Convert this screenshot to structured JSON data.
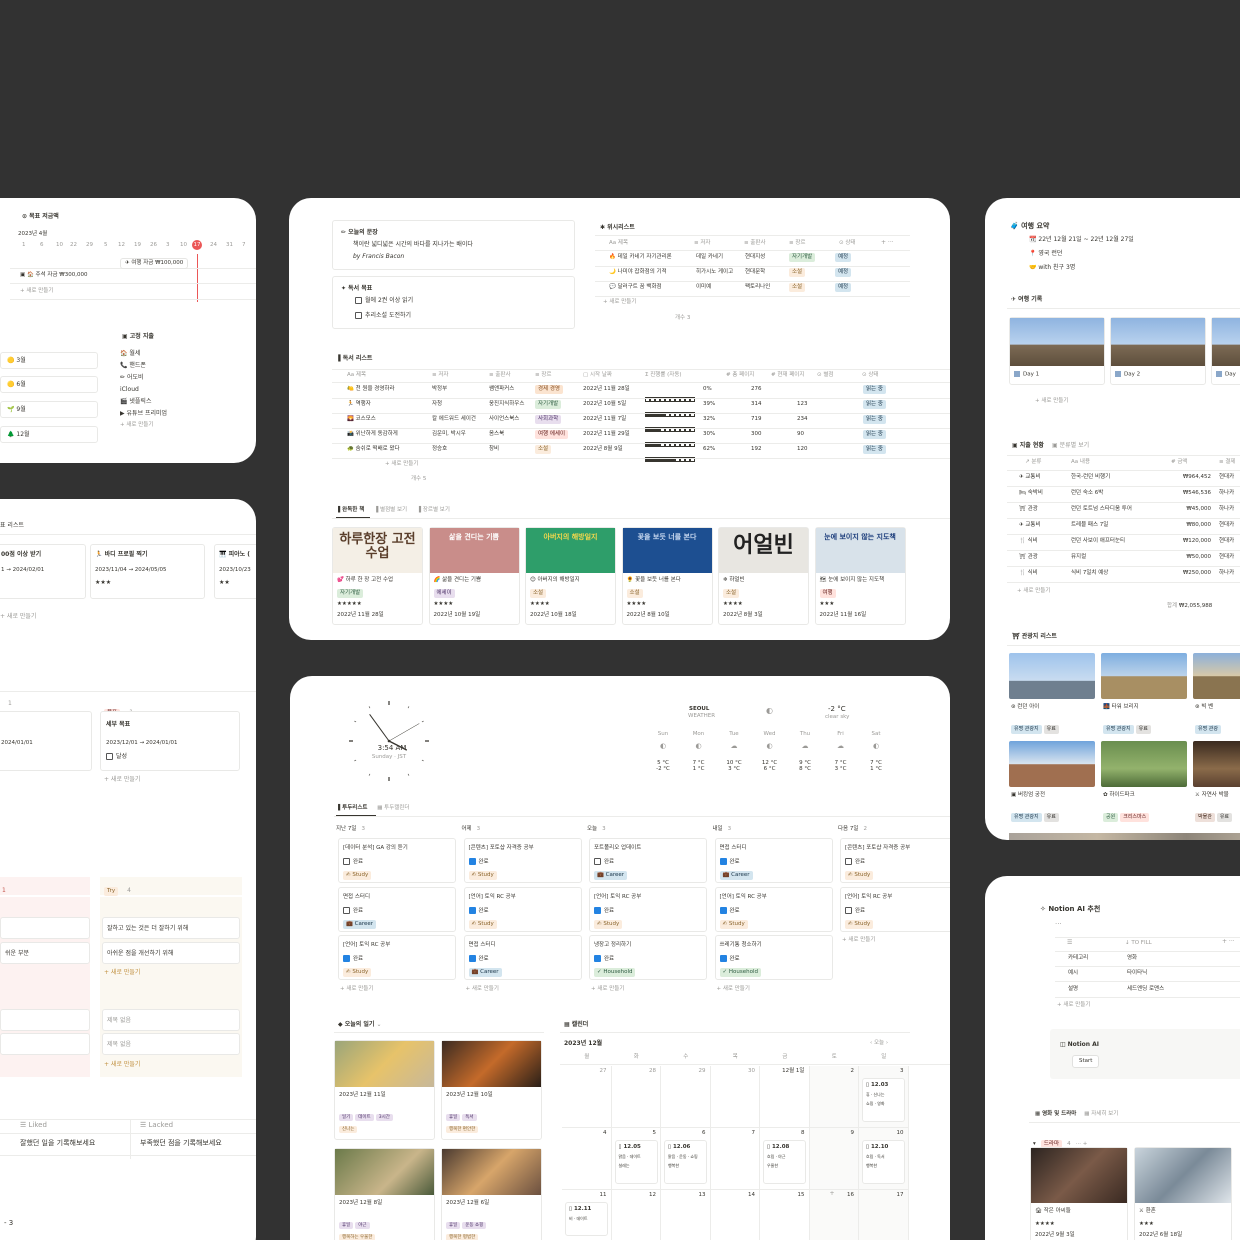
{
  "colors": {
    "bg": "#323232",
    "accent_red": "#eb5757",
    "blue": "#2383e2"
  },
  "saving": {
    "title": "목표 저금액",
    "month": "2023년 4월",
    "days": [
      "1",
      "6",
      "10",
      "22",
      "29",
      "5",
      "12",
      "19",
      "26",
      "3",
      "10",
      "17",
      "24",
      "31",
      "7"
    ],
    "today": "17",
    "bar1": "주석 자금  ₩300,000",
    "bar2": "여행 자금  ₩100,000",
    "add": "+ 새로 만들기"
  },
  "fixed": {
    "title": "고정 지출",
    "items": [
      "월세",
      "핸드폰",
      "어도비",
      "iCloud",
      "넷플릭스",
      "유튜브 프리미엄"
    ],
    "add": "+ 새로 만들기"
  },
  "months": [
    "3월",
    "6월",
    "9월",
    "12월"
  ],
  "goals": {
    "title": "표 리스트",
    "c1_title": "00점 이상 받기",
    "c1_date": "1 → 2024/02/01",
    "c2_title": "바디 프로필 찍기",
    "c2_date": "2023/11/04 → 2024/05/05",
    "c2_stars": "★★★",
    "c3_title": "피아노 (",
    "c3_date": "2023/10/23",
    "c3_stars": "★★",
    "add": "+ 새로 만들기"
  },
  "board": {
    "h1": "1",
    "h2_tag": "목표",
    "h2_count": "1",
    "c1_date": "2024/01/01",
    "c2_title": "세부 목표",
    "c2_date": "2023/12/01 → 2024/01/01",
    "c2_check": "달성",
    "add": "+ 새로 만들기"
  },
  "retro": {
    "try_tag": "Try",
    "try_count": "4",
    "left_tag": "",
    "row1": "잘하고 있는 것은 더 잘하기 위해",
    "row2_left": "쉬운 부분",
    "row2": "아쉬운 점을 개선하기 위해",
    "add": "+ 새로 만들기",
    "e1": "제목 없음",
    "e2": "제목 없음",
    "add2": "+ 새로 만들기"
  },
  "liked": {
    "h1": "Liked",
    "h2": "Lacked",
    "r1": "잘했던 일을 기록해보세요",
    "r2": "부족했던 점을 기록해보세요",
    "count": "3"
  },
  "quote": {
    "label": "오늘의 문장",
    "text": "책이란 넓디넓은 시간의 바다를 지나가는 배이다",
    "author": "by Francis Bacon"
  },
  "reading_goal": {
    "label": "독서 목표",
    "g1": "월에 2권 이상 읽기",
    "g2": "추리소설 도전하기"
  },
  "wish": {
    "title": "위시리스트",
    "cols": [
      "Aa 제목",
      "저자",
      "출판사",
      "장르",
      "상태"
    ],
    "rows": [
      [
        "데일 카네기 자기관리론",
        "데일 카네기",
        "현대지성",
        "자기개발",
        "예정"
      ],
      [
        "나미야 잡화점의 기적",
        "히가시노 게이고",
        "현대문학",
        "소설",
        "예정"
      ],
      [
        "달러구트 꿈 백화점",
        "이미예",
        "팩토리나인",
        "소설",
        "예정"
      ]
    ],
    "add": "+ 새로 만들기",
    "count": "개수 3"
  },
  "books": {
    "title": "독서 리스트",
    "cols": [
      "Aa 제목",
      "저자",
      "출판사",
      "장르",
      "시작 날짜",
      "진행률 (자동)",
      "총 페이지",
      "현재 페이지",
      "별점",
      "상태"
    ],
    "rows": [
      [
        "천 원을 경영하라",
        "박정부",
        "쌤앤파커스",
        "경제 경영",
        "2022년 11월 28일",
        "0%",
        "276",
        "",
        "읽는 중"
      ],
      [
        "역행자",
        "자청",
        "웅진지식하우스",
        "자기개발",
        "2022년 10월 5일",
        "39%",
        "314",
        "123",
        "읽는 중"
      ],
      [
        "코스모스",
        "칼 에드워드 세이건",
        "사이언스북스",
        "사회과학",
        "2022년 11월 7일",
        "32%",
        "719",
        "234",
        "읽는 중"
      ],
      [
        "위난하게 동감하게",
        "김운미, 박시우",
        "옴스북",
        "여행  에세이",
        "2022년 11월 29일",
        "30%",
        "300",
        "90",
        "읽는 중"
      ],
      [
        "숨쉬로 떡배로 왔다",
        "정승호",
        "창비",
        "소설",
        "2022년 8월 9일",
        "62%",
        "192",
        "120",
        "읽는 중"
      ]
    ],
    "progress": [
      0,
      0.39,
      0.32,
      0.3,
      0.62
    ],
    "add": "+ 새로 만들기",
    "count": "개수 5"
  },
  "gallery": {
    "tabs": [
      "완독한 책",
      "별점별 보기",
      "장르별 보기"
    ],
    "items": [
      {
        "cover": "하루한장 고전 수업",
        "title": "하루 한 장 고전 수업",
        "tag": "자기개발",
        "stars": "★★★★★",
        "date": "2022년 11월 28일"
      },
      {
        "cover": "삶을 견디는 기쁨",
        "title": "삶을 견디는 기쁨",
        "tag": "에세이",
        "stars": "★★★★",
        "date": "2022년 10월 19일"
      },
      {
        "cover": "아버지의 해방일지",
        "title": "아버지의 해방일지",
        "tag": "소설",
        "stars": "★★★★",
        "date": "2022년 10월 18일"
      },
      {
        "cover": "꽃을 보듯 너를 본다",
        "title": "꽃을 보듯 너를 본다",
        "tag": "소설",
        "stars": "★★★★",
        "date": "2022년 8월 10일"
      },
      {
        "cover": "어얼빈",
        "title": "하얼빈",
        "tag": "소설",
        "stars": "★★★★",
        "date": "2022년 8월 3일"
      },
      {
        "cover": "눈에 보이지 않는 지도책",
        "title": "눈에 보이지 않는 지도책",
        "tag": "여행",
        "stars": "★★★",
        "date": "2022년 11월 16일"
      }
    ]
  },
  "trip": {
    "title": "여행 요약",
    "dates": "22년 12월 21일 ~ 22년 12월 27일",
    "place": "영국 런던",
    "with": "with 친구 3명",
    "rec": "여행 기록",
    "days": [
      "Day 1",
      "Day 2",
      "Day"
    ],
    "add": "+ 새로 만들기"
  },
  "spend": {
    "title": "지출 현황",
    "tab2": "분류별 보기",
    "cols": [
      "분류",
      "Aa 내용",
      "# 금액",
      "결제"
    ],
    "rows": [
      [
        "교통비",
        "한국-런던 비행기",
        "₩964,452",
        "현대카"
      ],
      [
        "숙박비",
        "런던 숙소 6박",
        "₩546,536",
        "하나카"
      ],
      [
        "관광",
        "런던 토트넘 스타디움 투어",
        "₩45,000",
        "하나카"
      ],
      [
        "교통비",
        "트레블 패스 7일",
        "₩80,000",
        "현대카"
      ],
      [
        "식비",
        "런던 사보이 애프터눈티",
        "₩120,000",
        "현대카"
      ],
      [
        "관광",
        "뮤지컬",
        "₩50,000",
        "현대카"
      ],
      [
        "식비",
        "식비 7일치 예상",
        "₩250,000",
        "하나카"
      ]
    ],
    "add": "+ 새로 만들기",
    "total": "₩2,055,988"
  },
  "tour": {
    "title": "관광지 리스트",
    "items": [
      {
        "name": "런던 아이",
        "tags": [
          "유명 관광지",
          "유료"
        ]
      },
      {
        "name": "타워 브리지",
        "tags": [
          "유명 관광지",
          "유료"
        ]
      },
      {
        "name": "빅 벤",
        "tags": [
          "유명 관광"
        ]
      },
      {
        "name": "버킹엄 궁전",
        "tags": [
          "유명 관광지",
          "유료"
        ]
      },
      {
        "name": "하이드파크",
        "tags": [
          "공원",
          "크리스마스"
        ]
      },
      {
        "name": "자연사 박물",
        "tags": [
          "박물관",
          "유료"
        ]
      }
    ]
  },
  "clock": {
    "time": "3:54 AM",
    "day": "Sunday · JST"
  },
  "weather": {
    "city": "SEOUL",
    "label": "WEATHER",
    "temp": "-2 °C",
    "cond": "clear sky",
    "days": [
      "Sun",
      "Mon",
      "Tue",
      "Wed",
      "Thu",
      "Fri",
      "Sat"
    ],
    "hi": [
      "5 °C",
      "7 °C",
      "10 °C",
      "12 °C",
      "9 °C",
      "7 °C",
      "7 °C"
    ],
    "lo": [
      "-2 °C",
      "1 °C",
      "3 °C",
      "6 °C",
      "8 °C",
      "3 °C",
      "1 °C"
    ]
  },
  "todo": {
    "tabs": [
      "투두리스트",
      "투두캘린더"
    ],
    "cols": [
      {
        "h": "지난 7일",
        "n": "3",
        "cards": [
          [
            "[데이터 분석] GA 강의 듣기",
            "완료",
            "Study",
            false
          ],
          [
            "면접 스터디",
            "완료",
            "Career",
            false
          ],
          [
            "[언어] 토익 RC 공부",
            "완료",
            "Study",
            true
          ]
        ]
      },
      {
        "h": "어제",
        "n": "3",
        "cards": [
          [
            "[콘텐츠] 포토샵 자격증 공부",
            "완료",
            "Study",
            true
          ],
          [
            "[언어] 토익 RC 공부",
            "완료",
            "Study",
            true
          ],
          [
            "면접 스터디",
            "완료",
            "Career",
            true
          ]
        ]
      },
      {
        "h": "오늘",
        "n": "3",
        "cards": [
          [
            "포트폴리오 업데이트",
            "완료",
            "Career",
            false
          ],
          [
            "[언어] 토익 RC 공부",
            "완료",
            "Study",
            true
          ],
          [
            "냉장고 정리하기",
            "완료",
            "Household",
            true
          ]
        ]
      },
      {
        "h": "내일",
        "n": "3",
        "cards": [
          [
            "면접 스터디",
            "완료",
            "Career",
            true
          ],
          [
            "[언어] 토익 RC 공부",
            "완료",
            "Study",
            true
          ],
          [
            "쓰레기통 청소하기",
            "완료",
            "Household",
            true
          ]
        ]
      },
      {
        "h": "다음 7일",
        "n": "2",
        "cards": [
          [
            "[콘텐츠] 포토샵 자격증 공부",
            "완료",
            "Study",
            false
          ],
          [
            "[언어] 토익 RC 공부",
            "완료",
            "Study",
            false
          ]
        ]
      }
    ],
    "add": "+ 새로 만들기"
  },
  "diary": {
    "title": "오늘의 일기",
    "entries": [
      {
        "date": "2023년 12월 11일",
        "t": [
          "일기",
          "데이트",
          "3시간"
        ],
        "mood": "신나는"
      },
      {
        "date": "2023년 12월 10일",
        "t": [
          "휴일",
          "독서"
        ],
        "mood": "행복한  편안한"
      },
      {
        "date": "2023년 12월 8일",
        "t": [
          "휴일",
          "야근"
        ],
        "mood": "행복하는  우울한"
      },
      {
        "date": "2023년 12월 6일",
        "t": [
          "휴일",
          "운동  쇼핑"
        ],
        "mood": "행복한  평범한"
      }
    ]
  },
  "cal": {
    "title": "캘린더",
    "month": "2023년 12월",
    "today": "오늘",
    "wd": [
      "월",
      "화",
      "수",
      "목",
      "금",
      "토",
      "일"
    ],
    "w1": [
      "27",
      "28",
      "29",
      "30",
      "12월 1일",
      "2",
      "3"
    ],
    "w2": [
      "4",
      "5",
      "6",
      "7",
      "8",
      "9",
      "10"
    ],
    "w3": [
      "11",
      "12",
      "13",
      "14",
      "15",
      "16",
      "17"
    ],
    "e3": "12.03",
    "e5": "12.05",
    "e6": "12.06",
    "e8": "12.08",
    "e10": "12.10",
    "e11": "12.11"
  },
  "ai": {
    "title": "Notion AI 추천",
    "fill": "TO FILL",
    "rows": [
      [
        "카테고리",
        "영화"
      ],
      [
        "예시",
        "타이타닉"
      ],
      [
        "설명",
        "세드엔딩 로맨스"
      ]
    ],
    "add": "+ 새로 만들기",
    "name": "Notion AI",
    "start": "Start"
  },
  "movies": {
    "tabs": [
      "영화 및 드라마",
      "자세히 보기"
    ],
    "group": "드라마",
    "count": "4",
    "items": [
      {
        "title": "작은 아씨들",
        "stars": "★★★★",
        "date": "2022년 9월 3일"
      },
      {
        "title": "환혼",
        "stars": "★★★",
        "date": "2022년 6월 18일"
      }
    ]
  }
}
